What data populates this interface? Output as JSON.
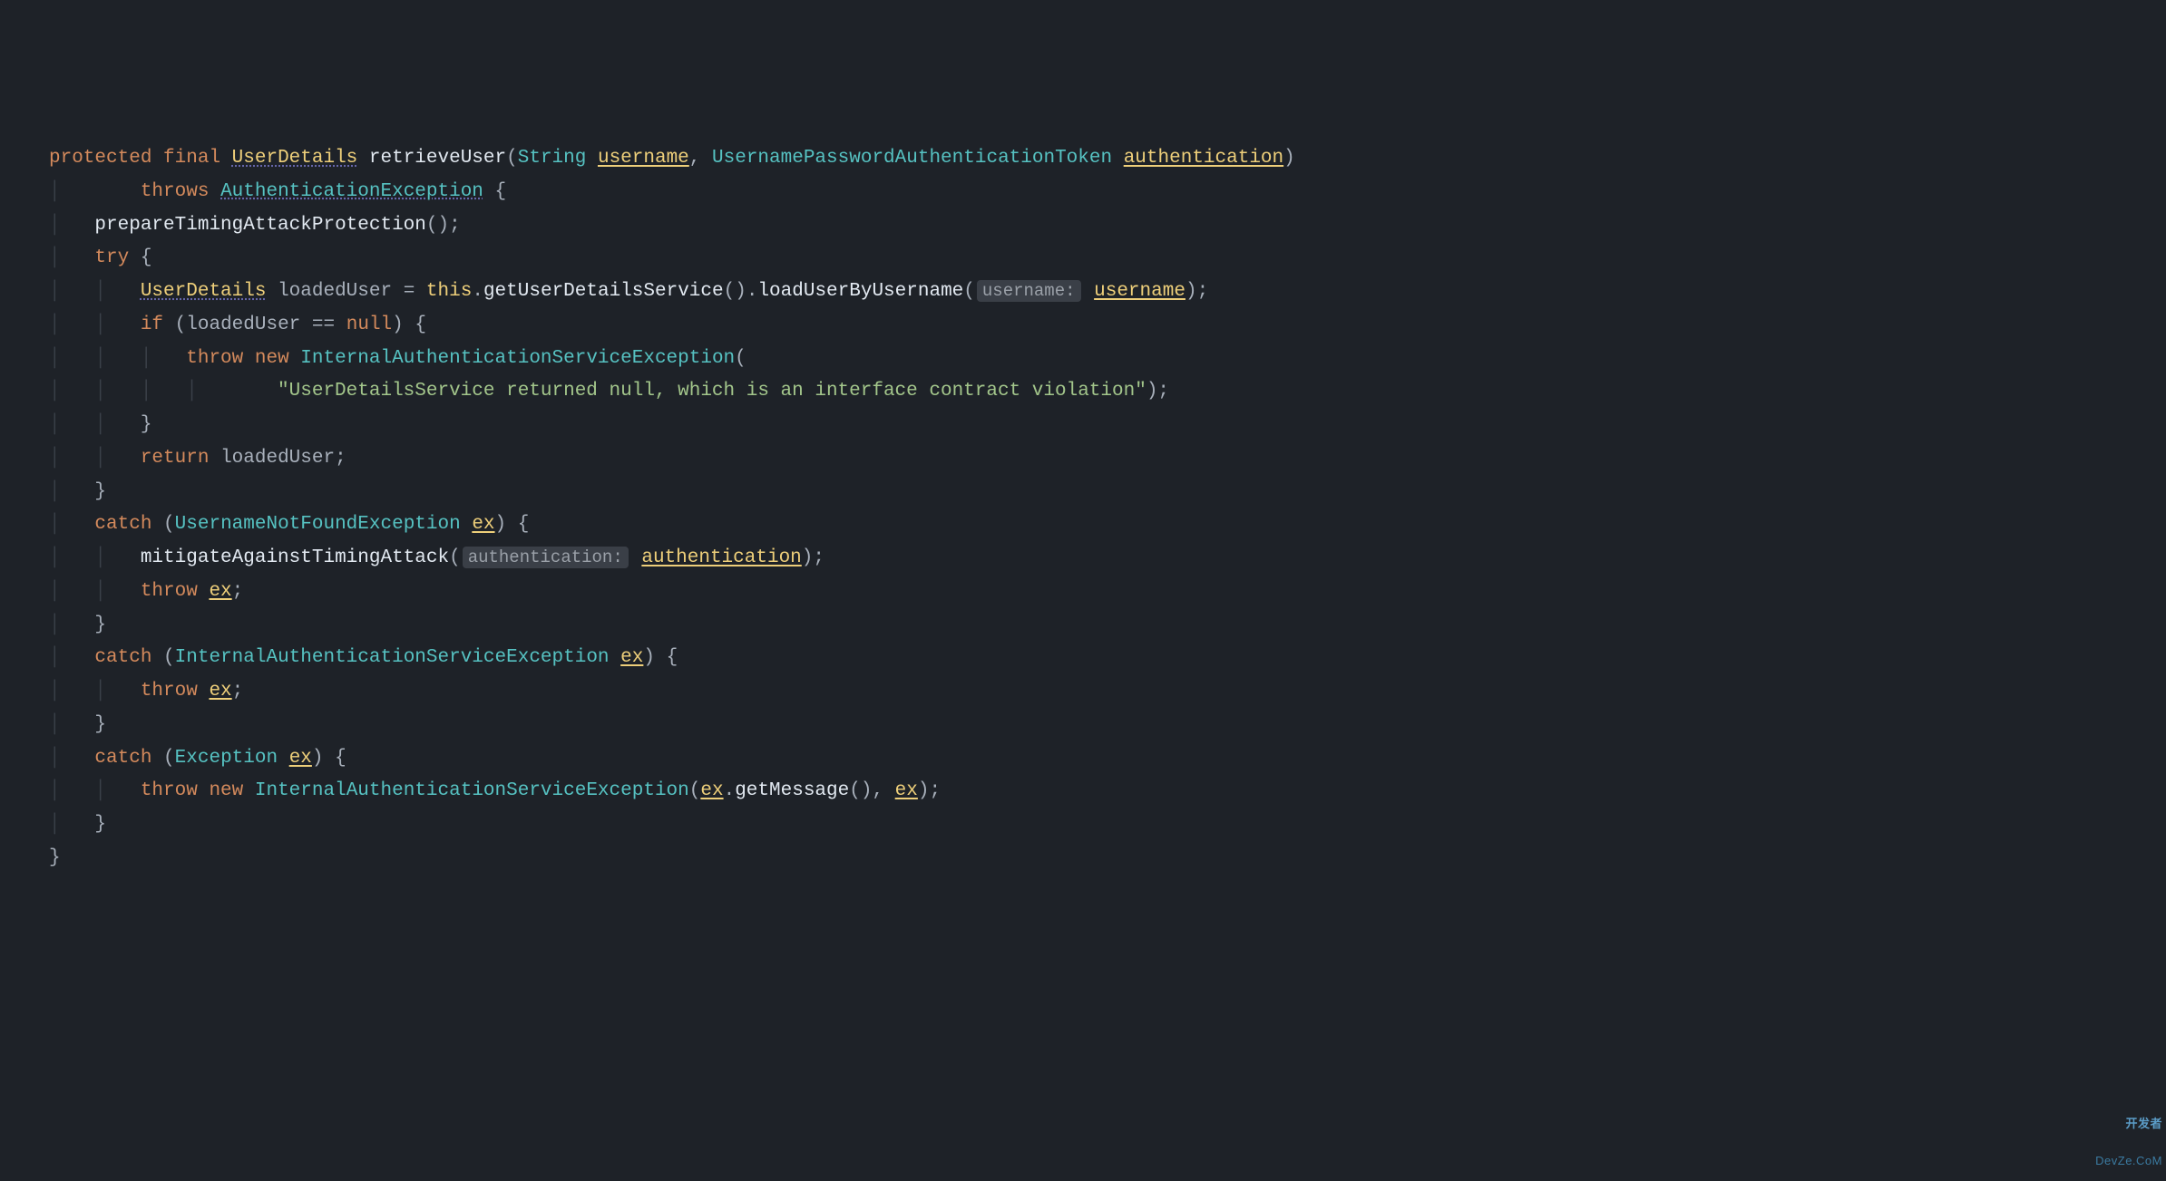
{
  "tokens": {
    "l1_protected": "protected",
    "l1_final": "final",
    "l1_UserDetails": "UserDetails",
    "l1_retrieveUser": "retrieveUser",
    "l1_String": "String",
    "l1_username": "username",
    "l1_UPAT": "UsernamePasswordAuthenticationToken",
    "l1_authentication": "authentication",
    "l2_throws": "throws",
    "l2_AuthEx": "AuthenticationException",
    "l3_prepareTiming": "prepareTimingAttackProtection",
    "l4_try": "try",
    "l5_UserDetails": "UserDetails",
    "l5_loadedUser": "loadedUser",
    "l5_this": "this",
    "l5_getUserDetailsService": "getUserDetailsService",
    "l5_loadUserByUsername": "loadUserByUsername",
    "l5_hint": "username:",
    "l5_username": "username",
    "l6_if": "if",
    "l6_loadedUser": "loadedUser",
    "l6_null": "null",
    "l7_throw": "throw",
    "l7_new": "new",
    "l7_IASE": "InternalAuthenticationServiceException",
    "l8_string": "\"UserDetailsService returned null, which is an interface contract violation\"",
    "l10_return": "return",
    "l10_loadedUser": "loadedUser",
    "l12_catch": "catch",
    "l12_UNFE": "UsernameNotFoundException",
    "l12_ex": "ex",
    "l13_mitigate": "mitigateAgainstTimingAttack",
    "l13_hint": "authentication:",
    "l13_authentication": "authentication",
    "l14_throw": "throw",
    "l14_ex": "ex",
    "l16_catch": "catch",
    "l16_IASE": "InternalAuthenticationServiceException",
    "l16_ex": "ex",
    "l17_throw": "throw",
    "l17_ex": "ex",
    "l19_catch": "catch",
    "l19_Exception": "Exception",
    "l19_ex": "ex",
    "l20_throw": "throw",
    "l20_new": "new",
    "l20_IASE": "InternalAuthenticationServiceException",
    "l20_ex1": "ex",
    "l20_getMessage": "getMessage",
    "l20_ex2": "ex"
  },
  "watermark": {
    "line1": "开发者",
    "line2": "DevZe.CoM"
  }
}
